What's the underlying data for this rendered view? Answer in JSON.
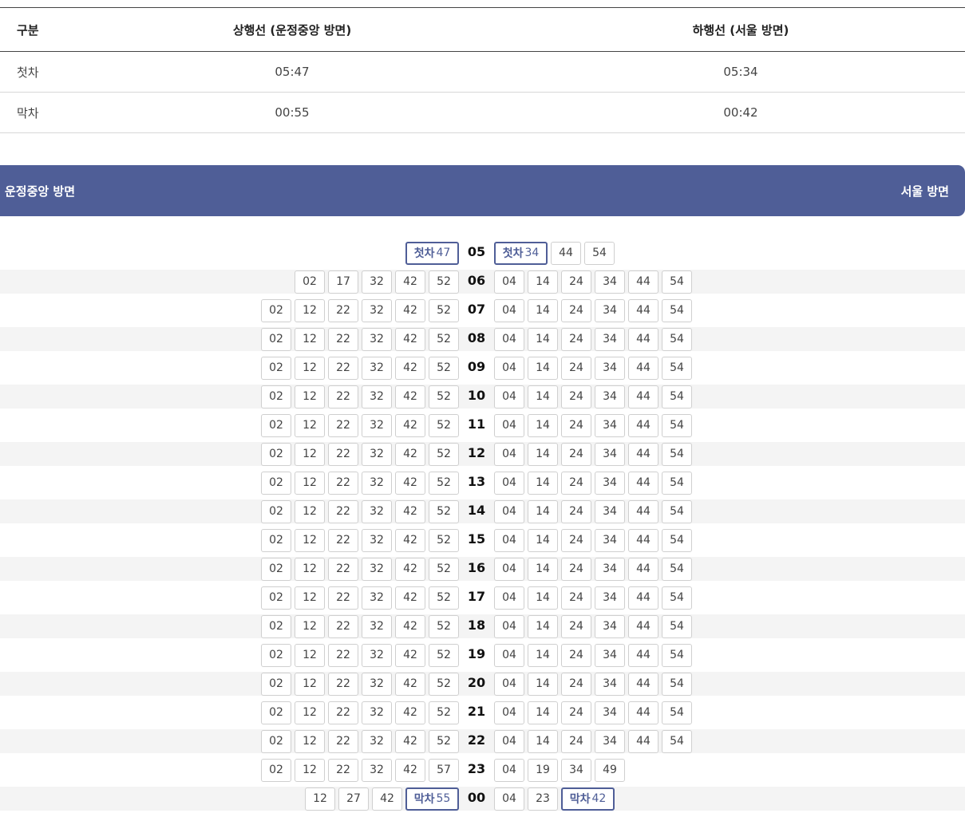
{
  "summary": {
    "headers": [
      "구분",
      "상행선 (운정중앙 방면)",
      "하행선 (서울 방면)"
    ],
    "rows": [
      [
        "첫차",
        "05:47",
        "05:34"
      ],
      [
        "막차",
        "00:55",
        "00:42"
      ]
    ]
  },
  "banner": {
    "left": "운정중앙 방면",
    "right": "서울 방면"
  },
  "colors": {
    "accent": "#4f5e97",
    "stripe": "#f4f4f4"
  },
  "timetable": [
    {
      "hour": "05",
      "up": [
        {
          "tag": "첫차",
          "min": "47"
        }
      ],
      "down": [
        {
          "tag": "첫차",
          "min": "34"
        },
        "44",
        "54"
      ]
    },
    {
      "hour": "06",
      "up": [
        "02",
        "17",
        "32",
        "42",
        "52"
      ],
      "down": [
        "04",
        "14",
        "24",
        "34",
        "44",
        "54"
      ]
    },
    {
      "hour": "07",
      "up": [
        "02",
        "12",
        "22",
        "32",
        "42",
        "52"
      ],
      "down": [
        "04",
        "14",
        "24",
        "34",
        "44",
        "54"
      ]
    },
    {
      "hour": "08",
      "up": [
        "02",
        "12",
        "22",
        "32",
        "42",
        "52"
      ],
      "down": [
        "04",
        "14",
        "24",
        "34",
        "44",
        "54"
      ]
    },
    {
      "hour": "09",
      "up": [
        "02",
        "12",
        "22",
        "32",
        "42",
        "52"
      ],
      "down": [
        "04",
        "14",
        "24",
        "34",
        "44",
        "54"
      ]
    },
    {
      "hour": "10",
      "up": [
        "02",
        "12",
        "22",
        "32",
        "42",
        "52"
      ],
      "down": [
        "04",
        "14",
        "24",
        "34",
        "44",
        "54"
      ]
    },
    {
      "hour": "11",
      "up": [
        "02",
        "12",
        "22",
        "32",
        "42",
        "52"
      ],
      "down": [
        "04",
        "14",
        "24",
        "34",
        "44",
        "54"
      ]
    },
    {
      "hour": "12",
      "up": [
        "02",
        "12",
        "22",
        "32",
        "42",
        "52"
      ],
      "down": [
        "04",
        "14",
        "24",
        "34",
        "44",
        "54"
      ]
    },
    {
      "hour": "13",
      "up": [
        "02",
        "12",
        "22",
        "32",
        "42",
        "52"
      ],
      "down": [
        "04",
        "14",
        "24",
        "34",
        "44",
        "54"
      ]
    },
    {
      "hour": "14",
      "up": [
        "02",
        "12",
        "22",
        "32",
        "42",
        "52"
      ],
      "down": [
        "04",
        "14",
        "24",
        "34",
        "44",
        "54"
      ]
    },
    {
      "hour": "15",
      "up": [
        "02",
        "12",
        "22",
        "32",
        "42",
        "52"
      ],
      "down": [
        "04",
        "14",
        "24",
        "34",
        "44",
        "54"
      ]
    },
    {
      "hour": "16",
      "up": [
        "02",
        "12",
        "22",
        "32",
        "42",
        "52"
      ],
      "down": [
        "04",
        "14",
        "24",
        "34",
        "44",
        "54"
      ]
    },
    {
      "hour": "17",
      "up": [
        "02",
        "12",
        "22",
        "32",
        "42",
        "52"
      ],
      "down": [
        "04",
        "14",
        "24",
        "34",
        "44",
        "54"
      ]
    },
    {
      "hour": "18",
      "up": [
        "02",
        "12",
        "22",
        "32",
        "42",
        "52"
      ],
      "down": [
        "04",
        "14",
        "24",
        "34",
        "44",
        "54"
      ]
    },
    {
      "hour": "19",
      "up": [
        "02",
        "12",
        "22",
        "32",
        "42",
        "52"
      ],
      "down": [
        "04",
        "14",
        "24",
        "34",
        "44",
        "54"
      ]
    },
    {
      "hour": "20",
      "up": [
        "02",
        "12",
        "22",
        "32",
        "42",
        "52"
      ],
      "down": [
        "04",
        "14",
        "24",
        "34",
        "44",
        "54"
      ]
    },
    {
      "hour": "21",
      "up": [
        "02",
        "12",
        "22",
        "32",
        "42",
        "52"
      ],
      "down": [
        "04",
        "14",
        "24",
        "34",
        "44",
        "54"
      ]
    },
    {
      "hour": "22",
      "up": [
        "02",
        "12",
        "22",
        "32",
        "42",
        "52"
      ],
      "down": [
        "04",
        "14",
        "24",
        "34",
        "44",
        "54"
      ]
    },
    {
      "hour": "23",
      "up": [
        "02",
        "12",
        "22",
        "32",
        "42",
        "57"
      ],
      "down": [
        "04",
        "19",
        "34",
        "49"
      ]
    },
    {
      "hour": "00",
      "up": [
        "12",
        "27",
        "42",
        {
          "tag": "막차",
          "min": "55"
        }
      ],
      "down": [
        "04",
        "23",
        {
          "tag": "막차",
          "min": "42"
        }
      ]
    }
  ]
}
